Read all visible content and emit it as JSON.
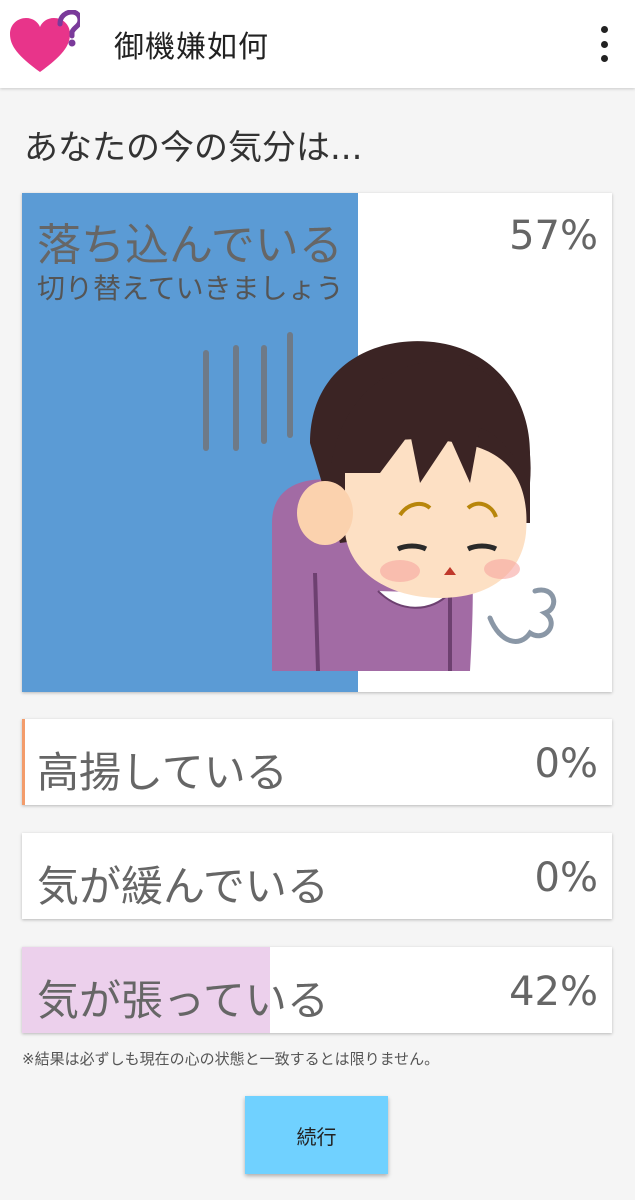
{
  "app_bar": {
    "title": "御機嫌如何",
    "logo_icon": "heart-question-icon",
    "menu_icon": "more-vert-icon"
  },
  "question": "あなたの今の気分は...",
  "results": [
    {
      "label": "落ち込んでいる",
      "percent_text": "57%",
      "percent": 57,
      "sub": "切り替えていきましょう",
      "color": "#5b9bd5"
    },
    {
      "label": "高揚している",
      "percent_text": "0%",
      "percent": 0,
      "color": "#f39c6b"
    },
    {
      "label": "気が緩んでいる",
      "percent_text": "0%",
      "percent": 0,
      "color": "#cccccc"
    },
    {
      "label": "気が張っている",
      "percent_text": "42%",
      "percent": 42,
      "color": "#ecd0ec"
    }
  ],
  "disclaimer": "※結果は必ずしも現在の心の状態と一致するとは限りません。",
  "continue_button": "続行"
}
